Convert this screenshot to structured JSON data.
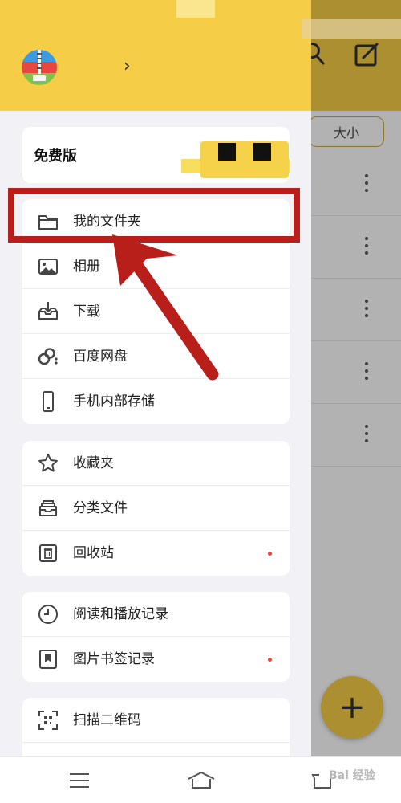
{
  "background_app": {
    "sort_chip_label": "大小",
    "fab_label": "+"
  },
  "drawer": {
    "plan_card": {
      "title": "免费版"
    },
    "groups": [
      {
        "items": [
          {
            "label": "我的文件夹",
            "icon": "folder-icon"
          },
          {
            "label": "相册",
            "icon": "image-icon"
          },
          {
            "label": "下载",
            "icon": "download-tray-icon"
          },
          {
            "label": "百度网盘",
            "icon": "cloud-drive-icon"
          },
          {
            "label": "手机内部存储",
            "icon": "phone-icon"
          }
        ]
      },
      {
        "items": [
          {
            "label": "收藏夹",
            "icon": "star-icon"
          },
          {
            "label": "分类文件",
            "icon": "category-tray-icon"
          },
          {
            "label": "回收站",
            "icon": "trash-icon",
            "badge_dot": true
          }
        ]
      },
      {
        "items": [
          {
            "label": "阅读和播放记录",
            "icon": "clock-icon"
          },
          {
            "label": "图片书签记录",
            "icon": "bookmark-icon",
            "badge_dot": true
          }
        ]
      },
      {
        "items": [
          {
            "label": "扫描二维码",
            "icon": "qr-scan-icon"
          }
        ]
      }
    ]
  },
  "watermark": "Bai 经验",
  "colors": {
    "accent_yellow": "#f5cd47",
    "annotation_red": "#b81f1b",
    "badge_red": "#e34a3b"
  }
}
